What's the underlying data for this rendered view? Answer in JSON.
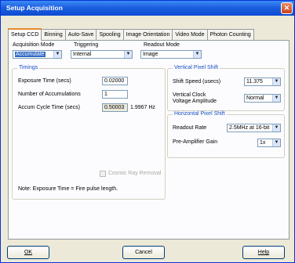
{
  "window": {
    "title": "Setup Acquisition",
    "close_glyph": "✕"
  },
  "tabs": [
    "Setup CCD",
    "Binning",
    "Auto-Save",
    "Spooling",
    "Image Orientation",
    "Video Mode",
    "Photon Counting"
  ],
  "top": {
    "acq_mode_label": "Acquisition Mode",
    "acq_mode_value": "Accumulate",
    "trigger_label": "Triggering",
    "trigger_value": "Internal",
    "readout_label": "Readout Mode",
    "readout_value": "Image",
    "arrow": "▼"
  },
  "timings": {
    "title": "Timings",
    "exposure_label": "Exposure Time (secs)",
    "exposure_value": "0.02000",
    "num_accum_label": "Number of Accumulations",
    "num_accum_value": "1",
    "cycle_label": "Accum Cycle Time (secs)",
    "cycle_value": "0.50003",
    "cycle_hz": "1.9967 Hz",
    "cosmic_label": "Cosmic Ray Removal",
    "note": "Note: Exposure Time = Fire pulse length."
  },
  "vertical": {
    "title": "Vertical Pixel Shift",
    "shift_label": "Shift Speed (usecs)",
    "shift_value": "11.375",
    "clock_label_1": "Vertical Clock",
    "clock_label_2": "Voltage Amplitude",
    "clock_value": "Normal"
  },
  "horizontal": {
    "title": "Horizontal Pixel Shift",
    "rate_label": "Readout Rate",
    "rate_value": "2.5MHz at 16-bit",
    "gain_label": "Pre-Amplifier Gain",
    "gain_value": "1x"
  },
  "buttons": {
    "ok": "OK",
    "cancel": "Cancel",
    "help": "Help"
  }
}
